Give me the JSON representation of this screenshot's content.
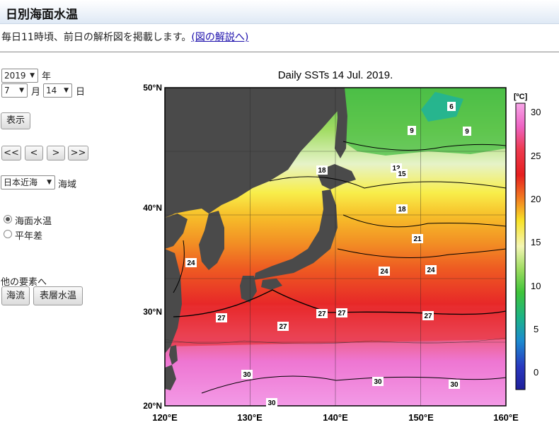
{
  "header": {
    "title": "日別海面水温"
  },
  "intro": {
    "text": "毎日11時頃、前日の解析図を掲載します。",
    "link": "(図の解説へ)"
  },
  "controls": {
    "year": "2019",
    "year_unit": "年",
    "month": "7",
    "month_unit": "月",
    "day": "14",
    "day_unit": "日",
    "show_button": "表示",
    "nav": [
      "<<",
      "<",
      ">",
      ">>"
    ],
    "region": "日本近海",
    "region_unit": "海域",
    "radio_sst": "海面水温",
    "radio_anom": "平年差",
    "other_label": "他の要素へ",
    "current_button": "海流",
    "layer_button": "表層水温"
  },
  "map": {
    "title": "Daily SSTs 14 Jul. 2019.",
    "lat_labels": [
      "50°N",
      "40°N",
      "30°N",
      "20°N"
    ],
    "lon_labels": [
      "120°E",
      "130°E",
      "140°E",
      "150°E",
      "160°E"
    ],
    "colorbar_unit": "[ºC]",
    "colorbar_ticks": [
      "30",
      "25",
      "20",
      "15",
      "10",
      "5",
      "0"
    ],
    "contour_labels": [
      "6",
      "9",
      "9",
      "18",
      "12",
      "15",
      "18",
      "21",
      "24",
      "24",
      "24",
      "27",
      "27",
      "27",
      "27",
      "27",
      "30",
      "30",
      "30",
      "30"
    ],
    "colors": {
      "land": "#4a4a4a",
      "warm": "#e8262a",
      "hot": "#ee74d0",
      "cold": "#3cc43c"
    }
  }
}
